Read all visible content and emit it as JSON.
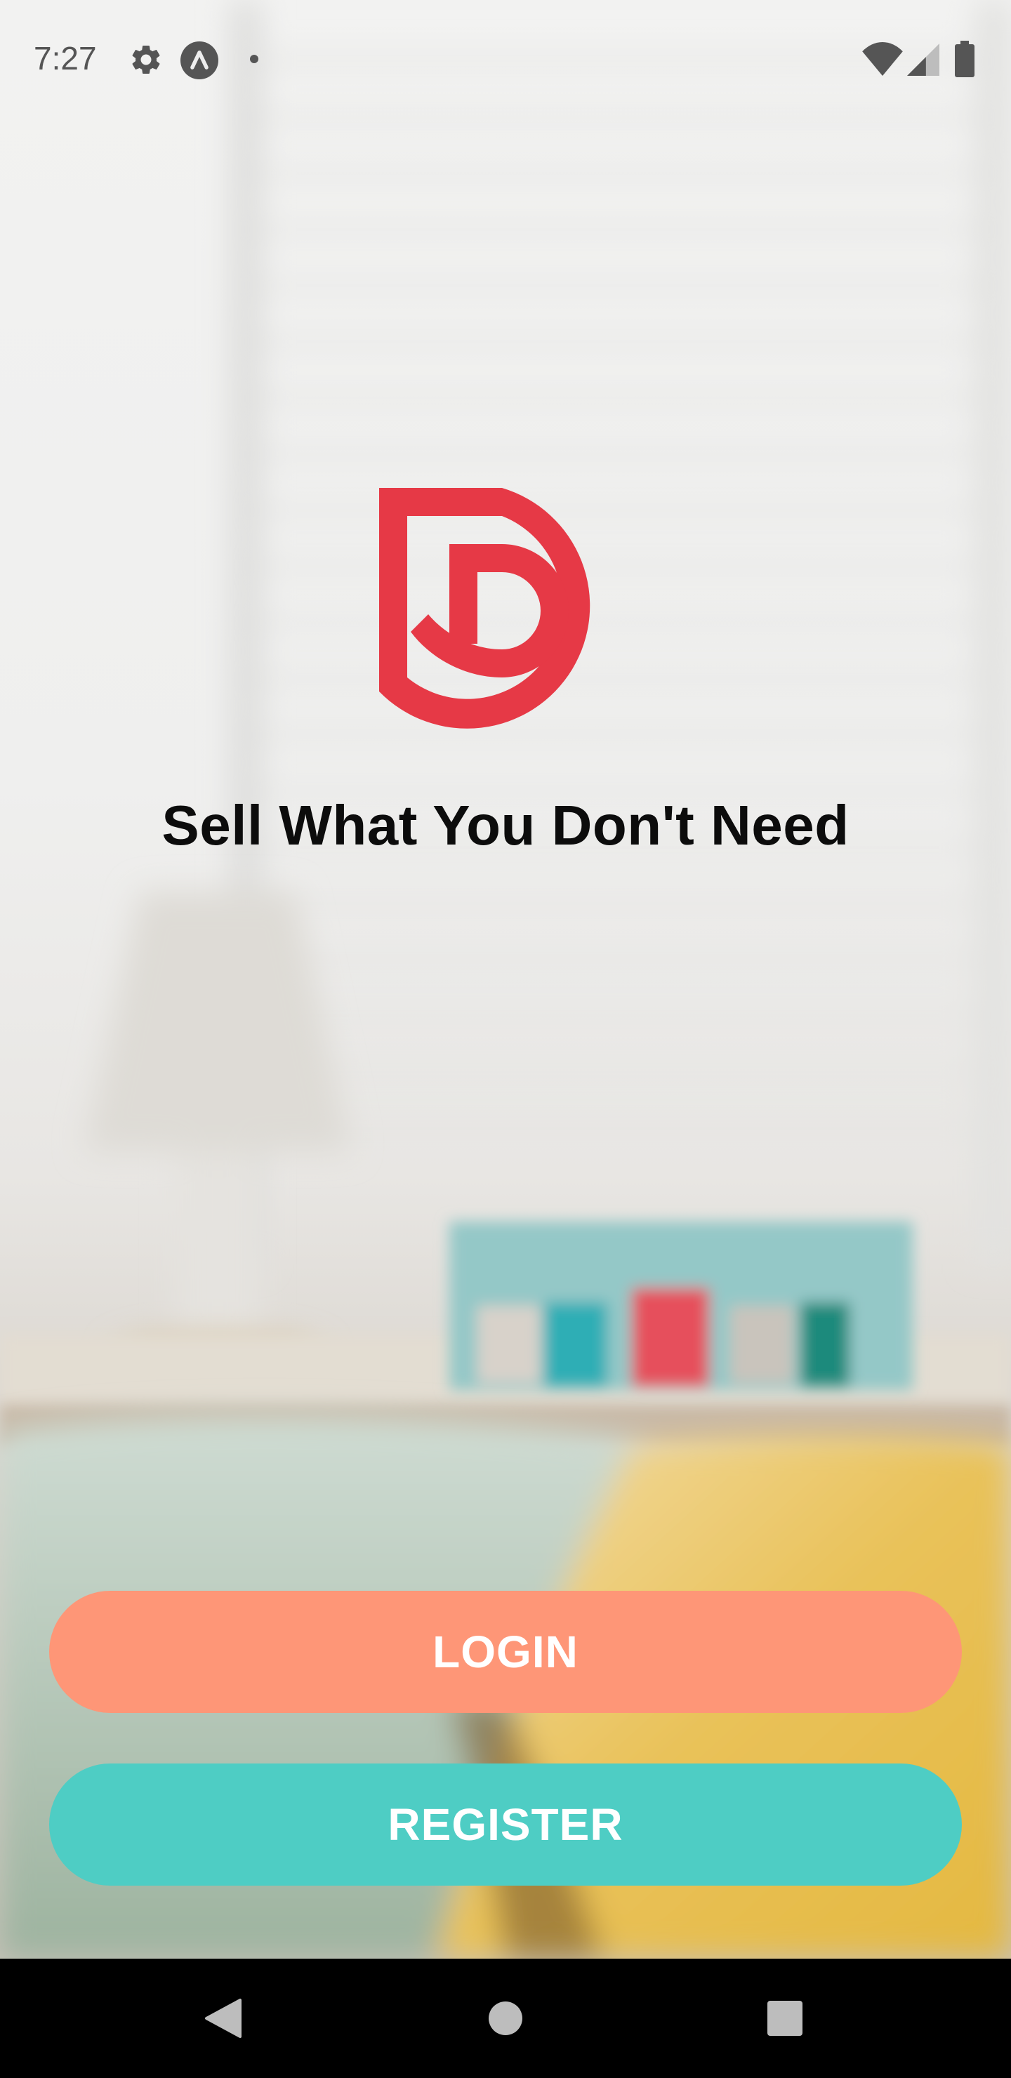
{
  "status_bar": {
    "time": "7:27",
    "left_icons": [
      "gear-icon",
      "app-notification-icon",
      "notification-dot-icon"
    ],
    "right_icons": [
      "wifi-icon",
      "cellular-signal-icon",
      "battery-icon"
    ]
  },
  "brand": {
    "logo": "d-logo",
    "logo_color": "#e63946",
    "tagline": "Sell What You Don't Need"
  },
  "buttons": {
    "login_label": "LOGIN",
    "login_color": "#fe9677",
    "register_label": "REGISTER",
    "register_color": "#4ecdc4"
  },
  "nav_bar": {
    "icons": [
      "back-icon",
      "home-icon",
      "recents-icon"
    ]
  }
}
